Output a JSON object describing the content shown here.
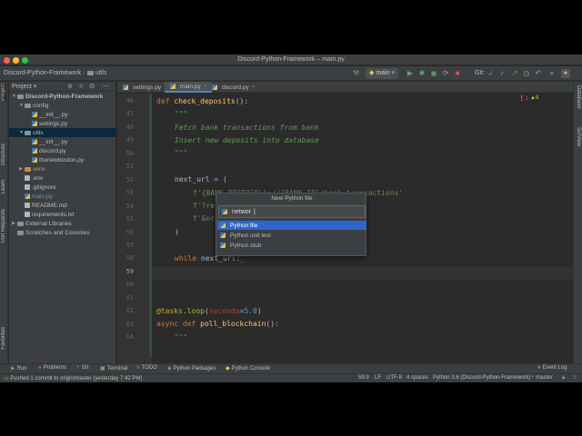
{
  "window": {
    "title": "Discord-Python-Framework – main.py",
    "traffic_colors": [
      "#ff5f57",
      "#febc2e",
      "#28c840"
    ]
  },
  "navbar": {
    "project": "Discord-Python-Framework",
    "folder": "utils",
    "branch": "main",
    "git_label": "Git:",
    "run_icon": "play-icon",
    "debug_icon": "bug-icon",
    "search_icon": "search-icon"
  },
  "left_tabs": [
    "Project",
    "Structure",
    "Learn",
    "Pull Requests",
    "Favorites"
  ],
  "right_tabs": [
    "Database",
    "SciView"
  ],
  "project_panel": {
    "header": "Project",
    "items": [
      {
        "label": "Discord-Python-Framework",
        "icon": "folder",
        "depth": 0,
        "arrow": "open",
        "bold": true
      },
      {
        "label": "config",
        "icon": "folder",
        "depth": 1,
        "arrow": "open"
      },
      {
        "label": "__init__.py",
        "icon": "py",
        "depth": 2
      },
      {
        "label": "settings.py",
        "icon": "py",
        "depth": 2
      },
      {
        "label": "utils",
        "icon": "folder",
        "depth": 1,
        "arrow": "open",
        "selected": true
      },
      {
        "label": "__init__.py",
        "icon": "py",
        "depth": 2
      },
      {
        "label": "discord.py",
        "icon": "py",
        "depth": 2
      },
      {
        "label": "thenewboston.py",
        "icon": "py",
        "depth": 2
      },
      {
        "label": "venv",
        "icon": "folder-orange",
        "depth": 1,
        "arrow": "closed"
      },
      {
        "label": ".env",
        "icon": "txt",
        "depth": 1
      },
      {
        "label": ".gitignore",
        "icon": "txt",
        "depth": 1
      },
      {
        "label": "main.py",
        "icon": "py",
        "depth": 1
      },
      {
        "label": "README.md",
        "icon": "txt",
        "depth": 1
      },
      {
        "label": "requirements.txt",
        "icon": "txt",
        "depth": 1
      },
      {
        "label": "External Libraries",
        "icon": "folder",
        "depth": 0,
        "arrow": "closed"
      },
      {
        "label": "Scratches and Consoles",
        "icon": "folder",
        "depth": 0
      }
    ]
  },
  "editor_tabs": [
    {
      "label": "settings.py",
      "active": false
    },
    {
      "label": "main.py",
      "active": true
    },
    {
      "label": "discord.py",
      "active": false
    }
  ],
  "editor": {
    "warning_errors": "1",
    "warning_weak": "8",
    "line_numbers": [
      "46",
      "47",
      "48",
      "49",
      "50",
      "51",
      "52",
      "53",
      "54",
      "55",
      "56",
      "57",
      "58",
      "59",
      "60",
      "61",
      "62",
      "63",
      "64"
    ],
    "current_line": "59"
  },
  "dialog": {
    "title": "New Python file",
    "input_value": "networ",
    "options": [
      {
        "label": "Python file",
        "selected": true
      },
      {
        "label": "Python unit test",
        "selected": false
      },
      {
        "label": "Python stub",
        "selected": false
      }
    ]
  },
  "bottom_tools": [
    "Run",
    "Problems",
    "Git",
    "Terminal",
    "TODO",
    "Python Packages",
    "Python Console",
    "Event Log"
  ],
  "status": {
    "message": "Pushed 1 commit to origin/master (yesterday 7:42 PM)",
    "position": "59:9",
    "line_sep": "LF",
    "encoding": "UTF-8",
    "indent": "4 spaces",
    "interpreter": "Python 3.6 (Discord-Python-Framework)",
    "branch": "master"
  }
}
